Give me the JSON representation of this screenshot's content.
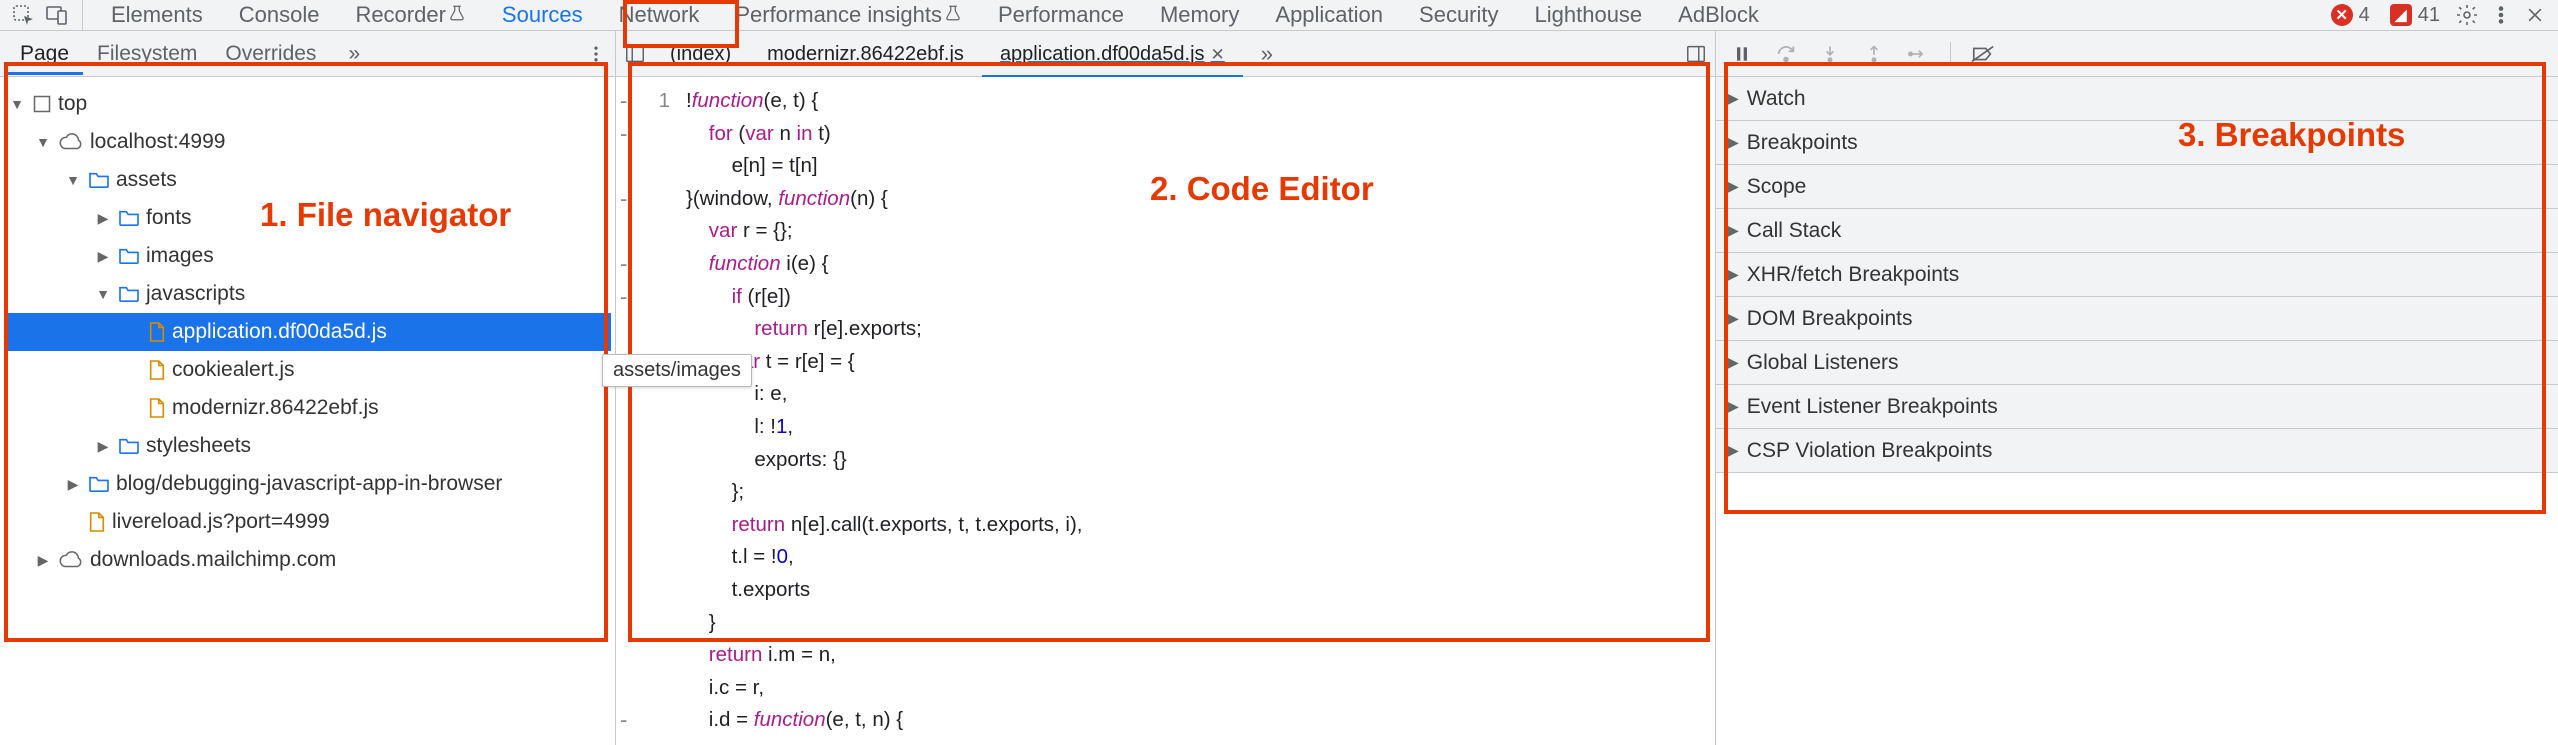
{
  "toolbar": {
    "tabs": [
      "Elements",
      "Console",
      "Recorder",
      "Sources",
      "Network",
      "Performance insights",
      "Performance",
      "Memory",
      "Application",
      "Security",
      "Lighthouse",
      "AdBlock"
    ],
    "active": "Sources",
    "beaker_tabs": [
      "Recorder",
      "Performance insights"
    ],
    "error_count": "4",
    "issue_count": "41"
  },
  "left_panel": {
    "tabs": [
      "Page",
      "Filesystem",
      "Overrides"
    ],
    "active": "Page",
    "more_glyph": "»",
    "tree": [
      {
        "d": 0,
        "expanded": true,
        "kind": "frame",
        "label": "top"
      },
      {
        "d": 1,
        "expanded": true,
        "kind": "domain",
        "label": "localhost:4999"
      },
      {
        "d": 2,
        "expanded": true,
        "kind": "folder",
        "label": "assets"
      },
      {
        "d": 3,
        "expanded": false,
        "kind": "folder",
        "label": "fonts"
      },
      {
        "d": 3,
        "expanded": false,
        "kind": "folder",
        "label": "images"
      },
      {
        "d": 3,
        "expanded": true,
        "kind": "folder",
        "label": "javascripts"
      },
      {
        "d": 4,
        "kind": "file-js",
        "label": "application.df00da5d.js",
        "selected": true
      },
      {
        "d": 4,
        "kind": "file-js",
        "label": "cookiealert.js"
      },
      {
        "d": 4,
        "kind": "file-js",
        "label": "modernizr.86422ebf.js"
      },
      {
        "d": 3,
        "expanded": false,
        "kind": "folder",
        "label": "stylesheets"
      },
      {
        "d": 2,
        "expanded": false,
        "kind": "folder",
        "label": "blog/debugging-javascript-app-in-browser"
      },
      {
        "d": 2,
        "kind": "file-js",
        "label": "livereload.js?port=4999"
      },
      {
        "d": 1,
        "expanded": false,
        "kind": "domain",
        "label": "downloads.mailchimp.com"
      }
    ],
    "hover_tooltip": "assets/images"
  },
  "editor_panel": {
    "open_files": [
      {
        "label": "(index)",
        "active": false
      },
      {
        "label": "modernizr.86422ebf.js",
        "active": false
      },
      {
        "label": "application.df00da5d.js",
        "active": true,
        "closeable": true
      }
    ],
    "more_glyph": "»",
    "gutter": [
      {
        "fold": "-",
        "ln": "1"
      },
      {
        "fold": "-",
        "ln": ""
      },
      {
        "fold": "",
        "ln": ""
      },
      {
        "fold": "-",
        "ln": ""
      },
      {
        "fold": "",
        "ln": ""
      },
      {
        "fold": "-",
        "ln": ""
      },
      {
        "fold": "-",
        "ln": ""
      },
      {
        "fold": "",
        "ln": ""
      },
      {
        "fold": "-",
        "ln": ""
      },
      {
        "fold": "",
        "ln": ""
      },
      {
        "fold": "",
        "ln": ""
      },
      {
        "fold": "",
        "ln": ""
      },
      {
        "fold": "",
        "ln": ""
      },
      {
        "fold": "",
        "ln": ""
      },
      {
        "fold": "",
        "ln": ""
      },
      {
        "fold": "",
        "ln": ""
      },
      {
        "fold": "",
        "ln": ""
      },
      {
        "fold": "",
        "ln": ""
      },
      {
        "fold": "",
        "ln": ""
      },
      {
        "fold": "-",
        "ln": ""
      }
    ],
    "code_lines": [
      [
        [
          "",
          "!"
        ],
        [
          "kw fn",
          "function"
        ],
        [
          "",
          "(e, t) {"
        ]
      ],
      [
        [
          "",
          "    "
        ],
        [
          "kw",
          "for"
        ],
        [
          "",
          " ("
        ],
        [
          "kw",
          "var"
        ],
        [
          "",
          " n "
        ],
        [
          "kw",
          "in"
        ],
        [
          "",
          " t)"
        ]
      ],
      [
        [
          "",
          "        e[n] = t[n]"
        ]
      ],
      [
        [
          "",
          "}(window, "
        ],
        [
          "kw fn",
          "function"
        ],
        [
          "",
          "(n) {"
        ]
      ],
      [
        [
          "",
          "    "
        ],
        [
          "kw",
          "var"
        ],
        [
          "",
          " r = {};"
        ]
      ],
      [
        [
          "",
          "    "
        ],
        [
          "kw fn",
          "function"
        ],
        [
          "",
          " i(e) {"
        ]
      ],
      [
        [
          "",
          "        "
        ],
        [
          "kw",
          "if"
        ],
        [
          "",
          " (r[e])"
        ]
      ],
      [
        [
          "",
          "            "
        ],
        [
          "kw",
          "return"
        ],
        [
          "",
          " r[e].exports;"
        ]
      ],
      [
        [
          "",
          "        "
        ],
        [
          "kw",
          "var"
        ],
        [
          "",
          " t = r[e] = {"
        ]
      ],
      [
        [
          "",
          "            i: e,"
        ]
      ],
      [
        [
          "",
          "            l: !"
        ],
        [
          "lit",
          "1"
        ],
        [
          "",
          ","
        ]
      ],
      [
        [
          "",
          "            exports: {}"
        ]
      ],
      [
        [
          "",
          "        };"
        ]
      ],
      [
        [
          "",
          "        "
        ],
        [
          "kw",
          "return"
        ],
        [
          "",
          " n[e].call(t.exports, t, t.exports, i),"
        ]
      ],
      [
        [
          "",
          "        t.l = !"
        ],
        [
          "lit",
          "0"
        ],
        [
          "",
          ","
        ]
      ],
      [
        [
          "",
          "        t.exports"
        ]
      ],
      [
        [
          "",
          "    }"
        ]
      ],
      [
        [
          "",
          "    "
        ],
        [
          "kw",
          "return"
        ],
        [
          "",
          " i.m = n,"
        ]
      ],
      [
        [
          "",
          "    i.c = r,"
        ]
      ],
      [
        [
          "",
          "    i.d = "
        ],
        [
          "kw fn",
          "function"
        ],
        [
          "",
          "(e, t, n) {"
        ]
      ]
    ]
  },
  "right_panel": {
    "sections": [
      "Watch",
      "Breakpoints",
      "Scope",
      "Call Stack",
      "XHR/fetch Breakpoints",
      "DOM Breakpoints",
      "Global Listeners",
      "Event Listener Breakpoints",
      "CSP Violation Breakpoints"
    ]
  },
  "annotations": {
    "file_nav": "1. File navigator",
    "code_editor": "2. Code Editor",
    "breakpoints": "3. Breakpoints"
  }
}
